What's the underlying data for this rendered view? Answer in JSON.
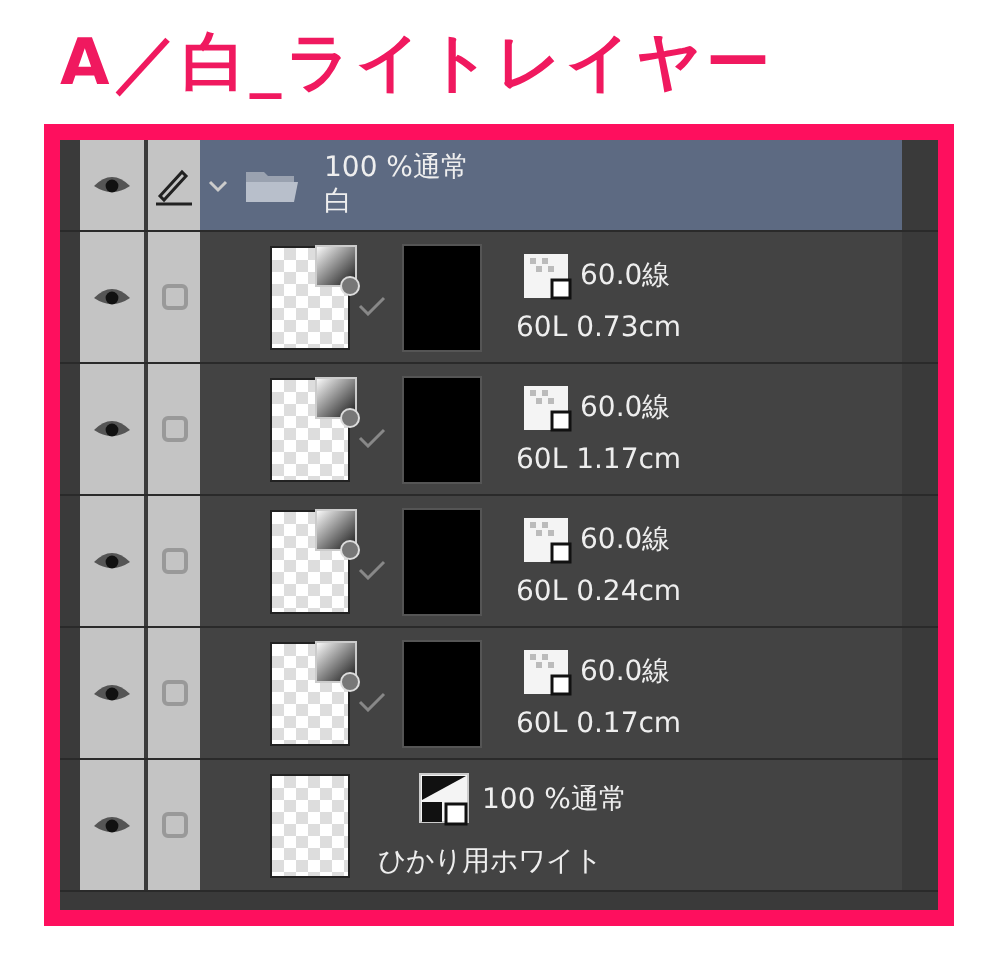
{
  "title": "A／白_ライトレイヤー",
  "group": {
    "mode": "100 %通常",
    "name": "白",
    "expanded": true,
    "selected": true,
    "visible": true
  },
  "layers": [
    {
      "kind": "tone",
      "visible": true,
      "checked": false,
      "tone": "60.0線",
      "info": "60L 0.73cm"
    },
    {
      "kind": "tone",
      "visible": true,
      "checked": false,
      "tone": "60.0線",
      "info": "60L 1.17cm"
    },
    {
      "kind": "tone",
      "visible": true,
      "checked": false,
      "tone": "60.0線",
      "info": "60L 0.24cm"
    },
    {
      "kind": "tone",
      "visible": true,
      "checked": false,
      "tone": "60.0線",
      "info": "60L 0.17cm"
    },
    {
      "kind": "raster",
      "visible": true,
      "checked": false,
      "mode": "100 %通常",
      "name": "ひかり用ホワイト"
    }
  ]
}
